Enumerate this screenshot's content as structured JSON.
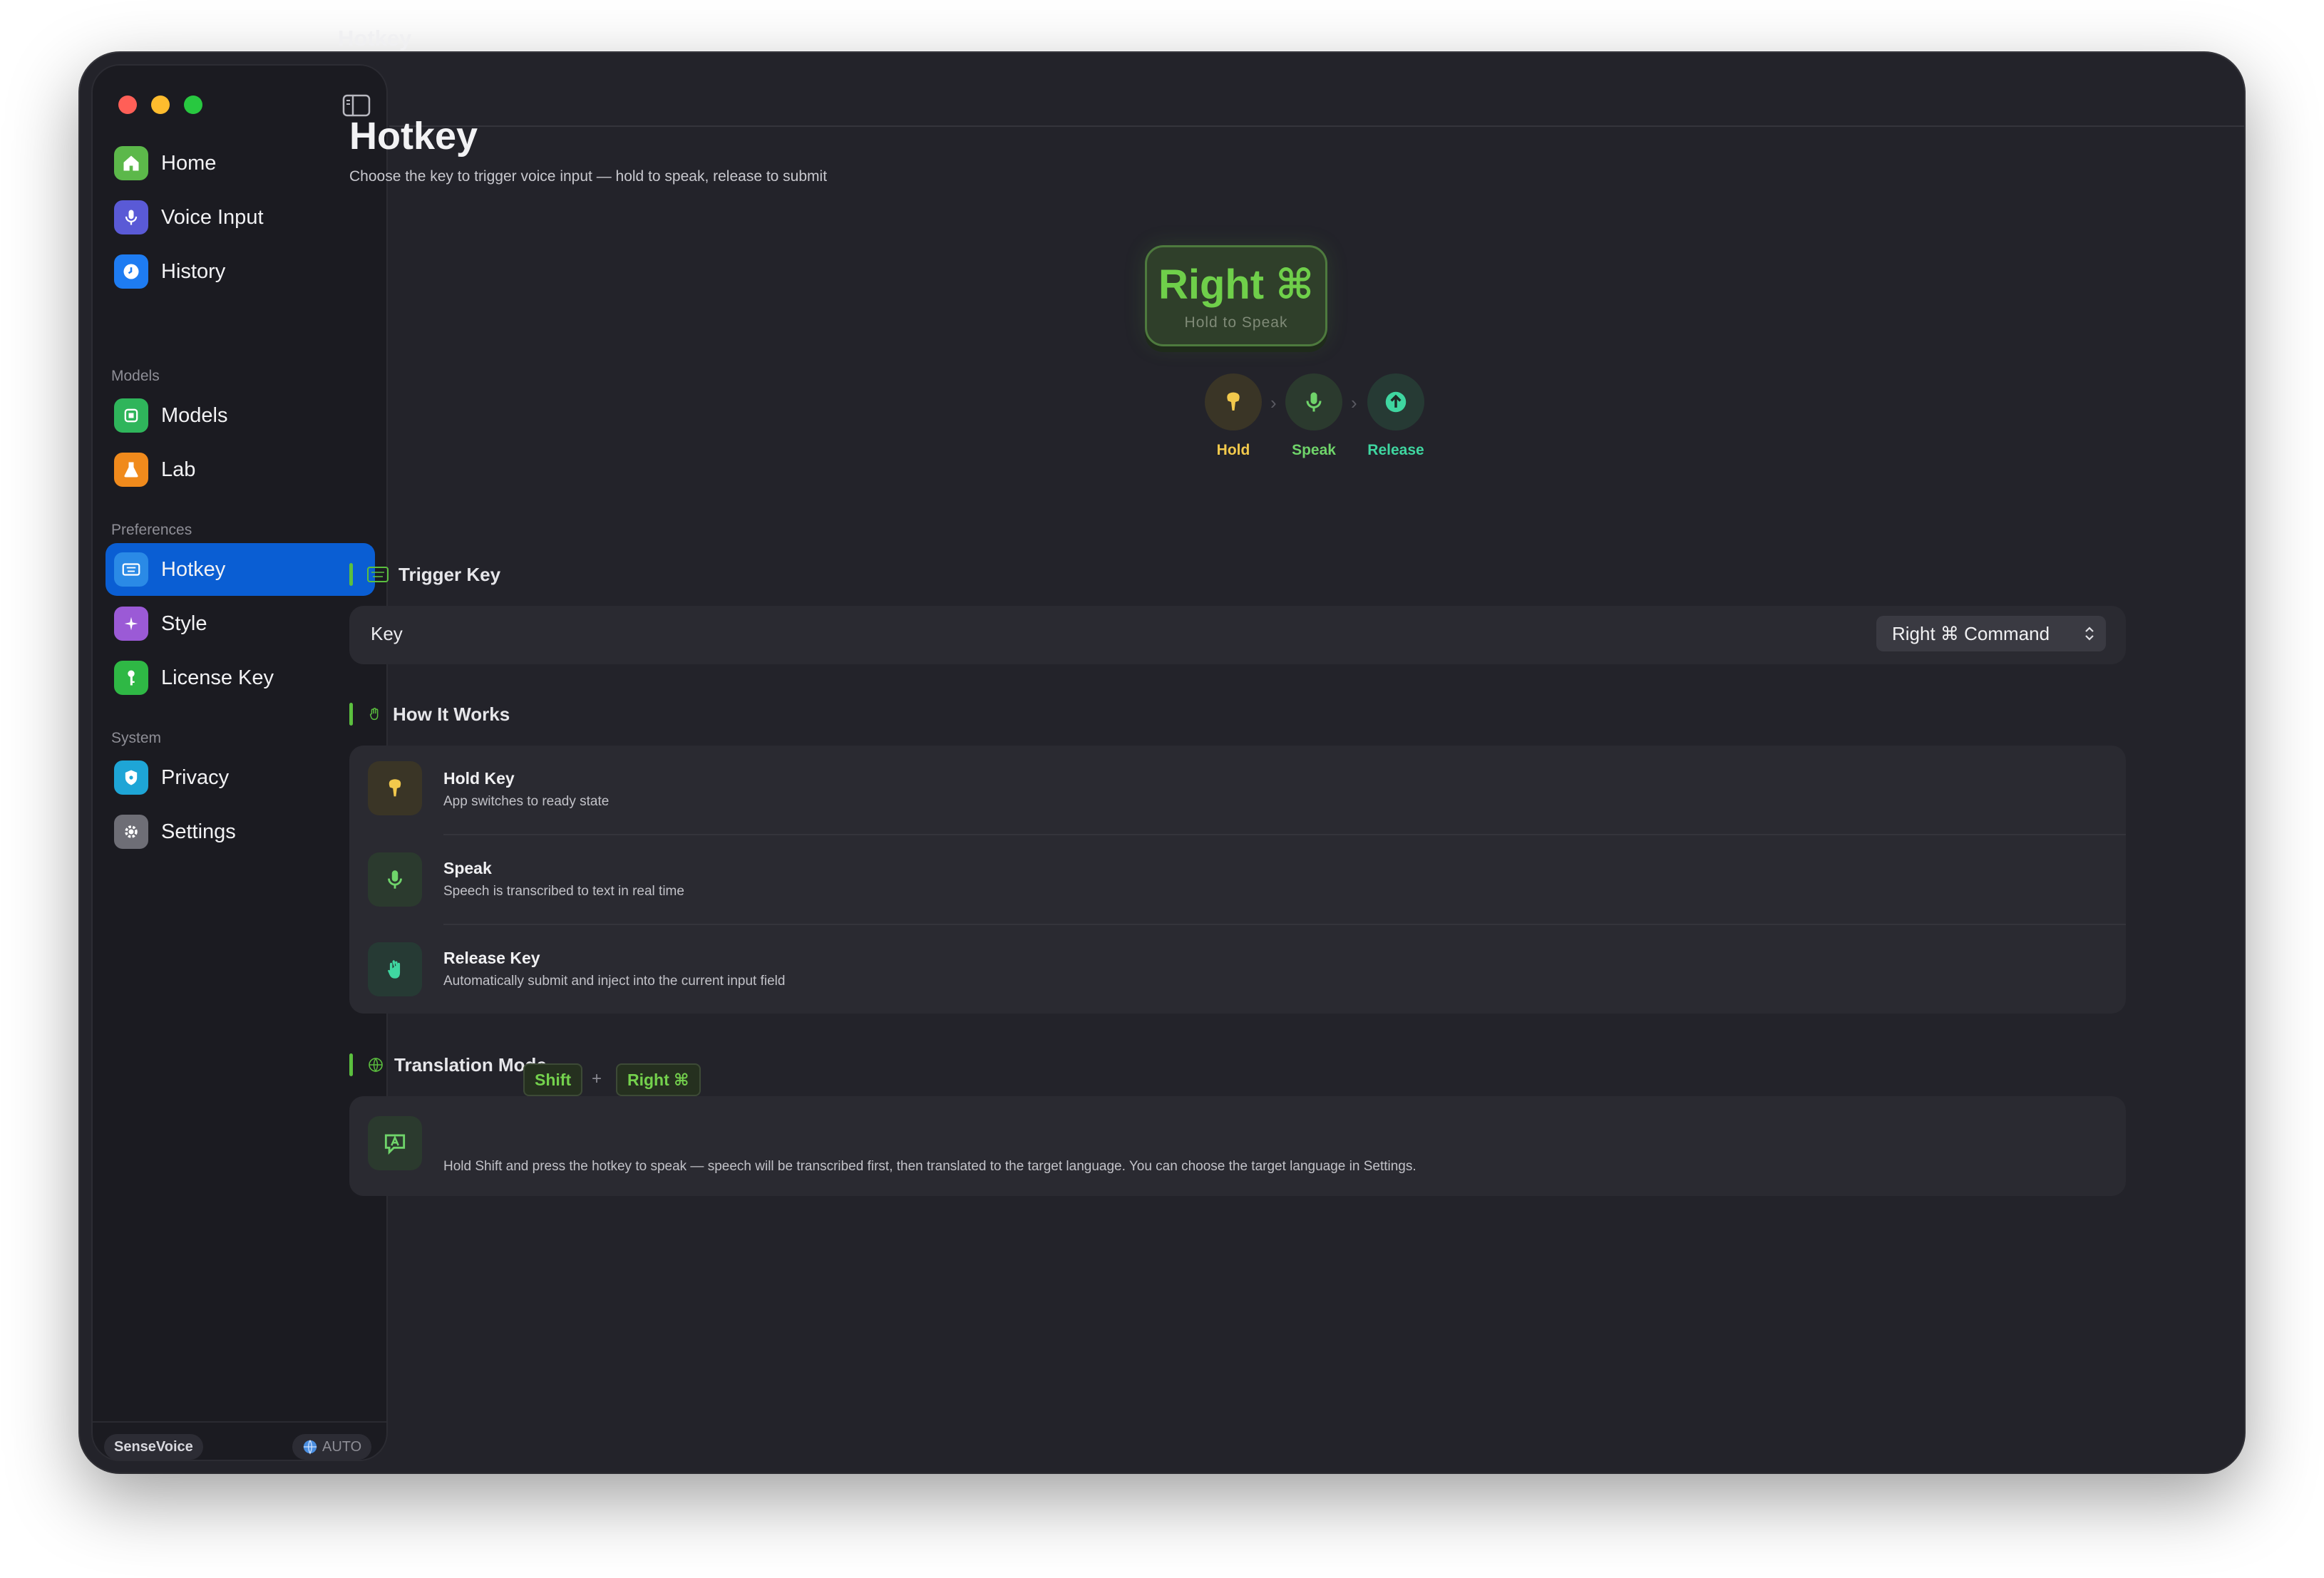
{
  "window": {
    "top_title": "Hotkey"
  },
  "sidebar": {
    "items": [
      {
        "label": "Home",
        "icon": "house-icon",
        "color": "#5cb84a"
      },
      {
        "label": "Voice Input",
        "icon": "microphone-icon",
        "color": "#5a5ad6"
      },
      {
        "label": "History",
        "icon": "clock-icon",
        "color": "#1e7cf2"
      },
      {
        "label": "Models",
        "icon": "chip-icon",
        "color": "#2fb55b"
      },
      {
        "label": "Lab",
        "icon": "flask-icon",
        "color": "#f08a1c"
      },
      {
        "label": "Hotkey",
        "icon": "keyboard-icon",
        "color": "#2a8ae6",
        "active": true
      },
      {
        "label": "Style",
        "icon": "sparkle-icon",
        "color": "#9b5ad6"
      },
      {
        "label": "License Key",
        "icon": "key-icon",
        "color": "#2fb845"
      },
      {
        "label": "Privacy",
        "icon": "shield-icon",
        "color": "#1ea5d6"
      },
      {
        "label": "Settings",
        "icon": "gear-icon",
        "color": "#6e6e76"
      }
    ],
    "sections": {
      "models": "Models",
      "preferences": "Preferences",
      "system": "System"
    },
    "footer": {
      "engine": "SenseVoice",
      "language": "AUTO"
    }
  },
  "page": {
    "title": "Hotkey",
    "subtitle": "Choose the key to trigger voice input — hold to speak, release to submit"
  },
  "keycap": {
    "label": "Right ⌘",
    "hint": "Hold to Speak",
    "accent": "#6fcf4a"
  },
  "steps": [
    {
      "label": "Hold",
      "color": "#f2c94c"
    },
    {
      "label": "Speak",
      "color": "#6fd46a"
    },
    {
      "label": "Release",
      "color": "#3fd6a0"
    }
  ],
  "trigger": {
    "title": "Trigger Key",
    "key_label": "Key",
    "selected": "Right ⌘ Command"
  },
  "how": {
    "title": "How It Works",
    "rows": [
      {
        "title": "Hold Key",
        "desc": "App switches to ready state"
      },
      {
        "title": "Speak",
        "desc": "Speech is transcribed to text in real time"
      },
      {
        "title": "Release Key",
        "desc": "Automatically submit and inject into the current input field"
      }
    ]
  },
  "translation": {
    "title": "Translation Mode",
    "key1": "Shift",
    "plus": "+",
    "key2": "Right ⌘",
    "desc": "Hold Shift and press the hotkey to speak — speech will be transcribed first, then translated to the target language. You can choose the target language in Settings."
  }
}
